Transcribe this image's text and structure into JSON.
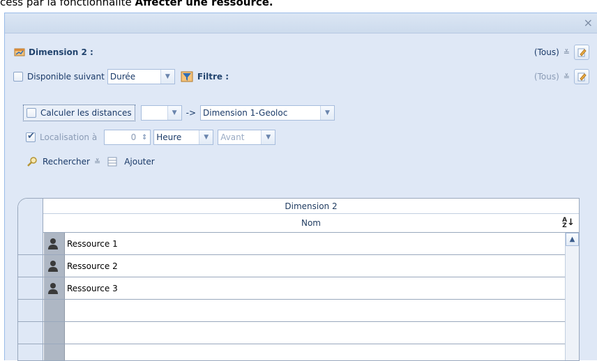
{
  "top_text": {
    "prefix": "cess par la fonctionnalité ",
    "bold": "Affecter une ressource."
  },
  "window": {
    "close_label": "×"
  },
  "dimension": {
    "label": "Dimension 2 :",
    "value": "(Tous)"
  },
  "dispo": {
    "label": "Disponible suivant",
    "combo_value": "Durée",
    "filtre_label": "Filtre :",
    "filtre_value": "(Tous)"
  },
  "distances": {
    "label": "Calculer les distances",
    "combo_value": "",
    "arrow": "->",
    "target_value": "Dimension 1-Geoloc"
  },
  "localisation": {
    "label": "Localisation à",
    "value": "0",
    "unit": "Heure",
    "when": "Avant"
  },
  "actions": {
    "search": "Rechercher",
    "add": "Ajouter"
  },
  "grid": {
    "group_header": "Dimension 2",
    "column_header": "Nom",
    "sort_glyph": "A↓Z",
    "rows": [
      "Ressource 1",
      "Ressource 2",
      "Ressource 3"
    ]
  },
  "colors": {
    "panel_bg": "#dfe8f6",
    "border": "#99bbe8",
    "accent": "#23456f"
  }
}
